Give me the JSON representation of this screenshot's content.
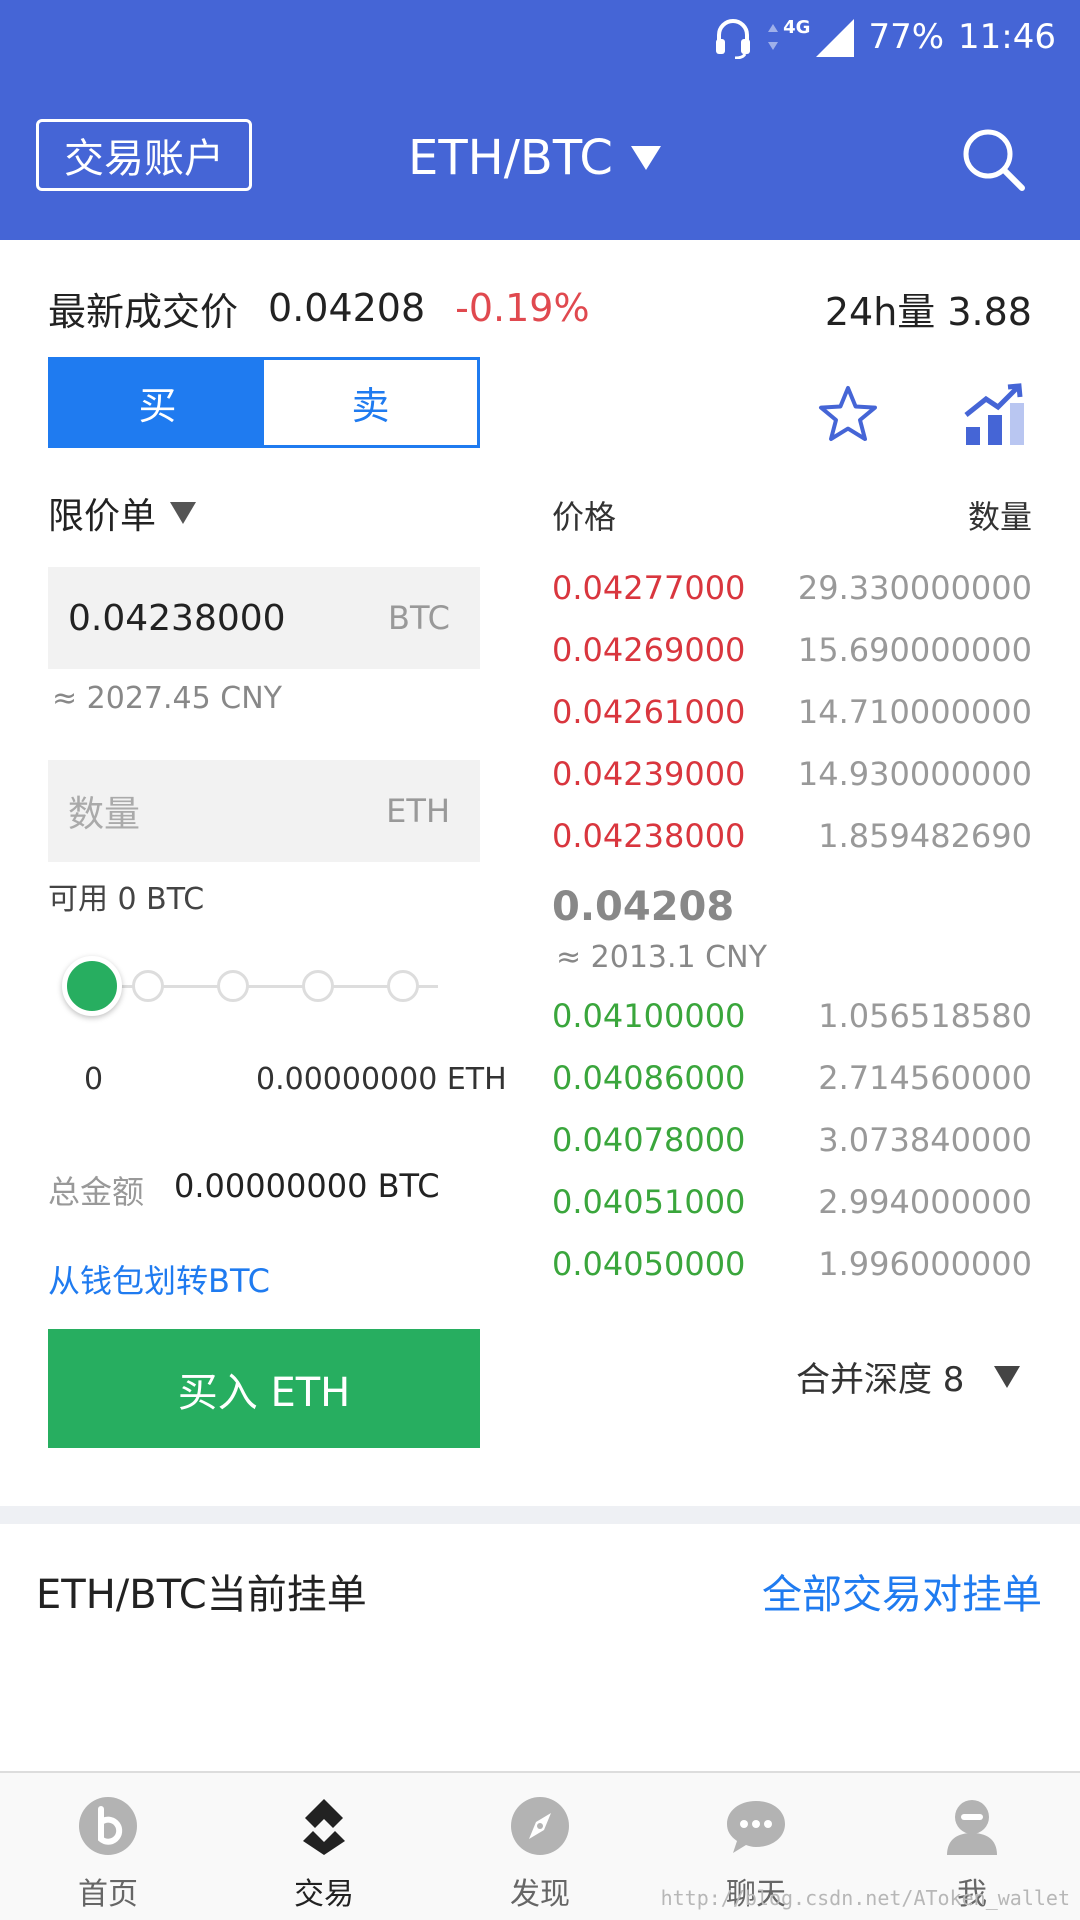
{
  "status_bar": {
    "network": "4G",
    "battery": "77%",
    "time": "11:46"
  },
  "header": {
    "account_label": "交易账户",
    "pair": "ETH/BTC"
  },
  "ticker": {
    "label": "最新成交价",
    "price": "0.04208",
    "change": "-0.19%",
    "volume": "24h量 3.88"
  },
  "tabs": {
    "buy": "买",
    "sell": "卖"
  },
  "form": {
    "order_type": "限价单",
    "price_value": "0.04238000",
    "price_unit": "BTC",
    "price_cny": "≈ 2027.45 CNY",
    "qty_placeholder": "数量",
    "qty_unit": "ETH",
    "available": "可用 0 BTC",
    "slider_percent": 0,
    "range_min": "0",
    "range_max": "0.00000000 ETH",
    "total_label": "总金额",
    "total_value": "0.00000000 BTC",
    "wallet_transfer": "从钱包划转BTC",
    "buy_button": "买入 ETH"
  },
  "book": {
    "price_header": "价格",
    "amount_header": "数量",
    "asks": [
      {
        "price": "0.04277000",
        "amount": "29.330000000"
      },
      {
        "price": "0.04269000",
        "amount": "15.690000000"
      },
      {
        "price": "0.04261000",
        "amount": "14.710000000"
      },
      {
        "price": "0.04239000",
        "amount": "14.930000000"
      },
      {
        "price": "0.04238000",
        "amount": "1.859482690"
      }
    ],
    "last_price": "0.04208",
    "last_price_cny": "≈ 2013.1 CNY",
    "bids": [
      {
        "price": "0.04100000",
        "amount": "1.056518580"
      },
      {
        "price": "0.04086000",
        "amount": "2.714560000"
      },
      {
        "price": "0.04078000",
        "amount": "3.073840000"
      },
      {
        "price": "0.04051000",
        "amount": "2.994000000"
      },
      {
        "price": "0.04050000",
        "amount": "1.996000000"
      }
    ],
    "depth_label": "合并深度 8"
  },
  "orders": {
    "title": "ETH/BTC当前挂单",
    "all_link": "全部交易对挂单"
  },
  "bottom_nav": [
    {
      "label": "首页",
      "icon": "home-icon",
      "active": false
    },
    {
      "label": "交易",
      "icon": "trade-icon",
      "active": true
    },
    {
      "label": "发现",
      "icon": "compass-icon",
      "active": false
    },
    {
      "label": "聊天",
      "icon": "chat-icon",
      "active": false
    },
    {
      "label": "我",
      "icon": "user-icon",
      "active": false
    }
  ],
  "watermark": "http://blog.csdn.net/AToken_wallet",
  "colors": {
    "header_blue": "#4565d6",
    "accent_blue": "#1f7bf0",
    "ask_red": "#d9363e",
    "bid_green": "#3aa63c",
    "buy_green": "#27ae60",
    "change_red": "#e0494f"
  }
}
